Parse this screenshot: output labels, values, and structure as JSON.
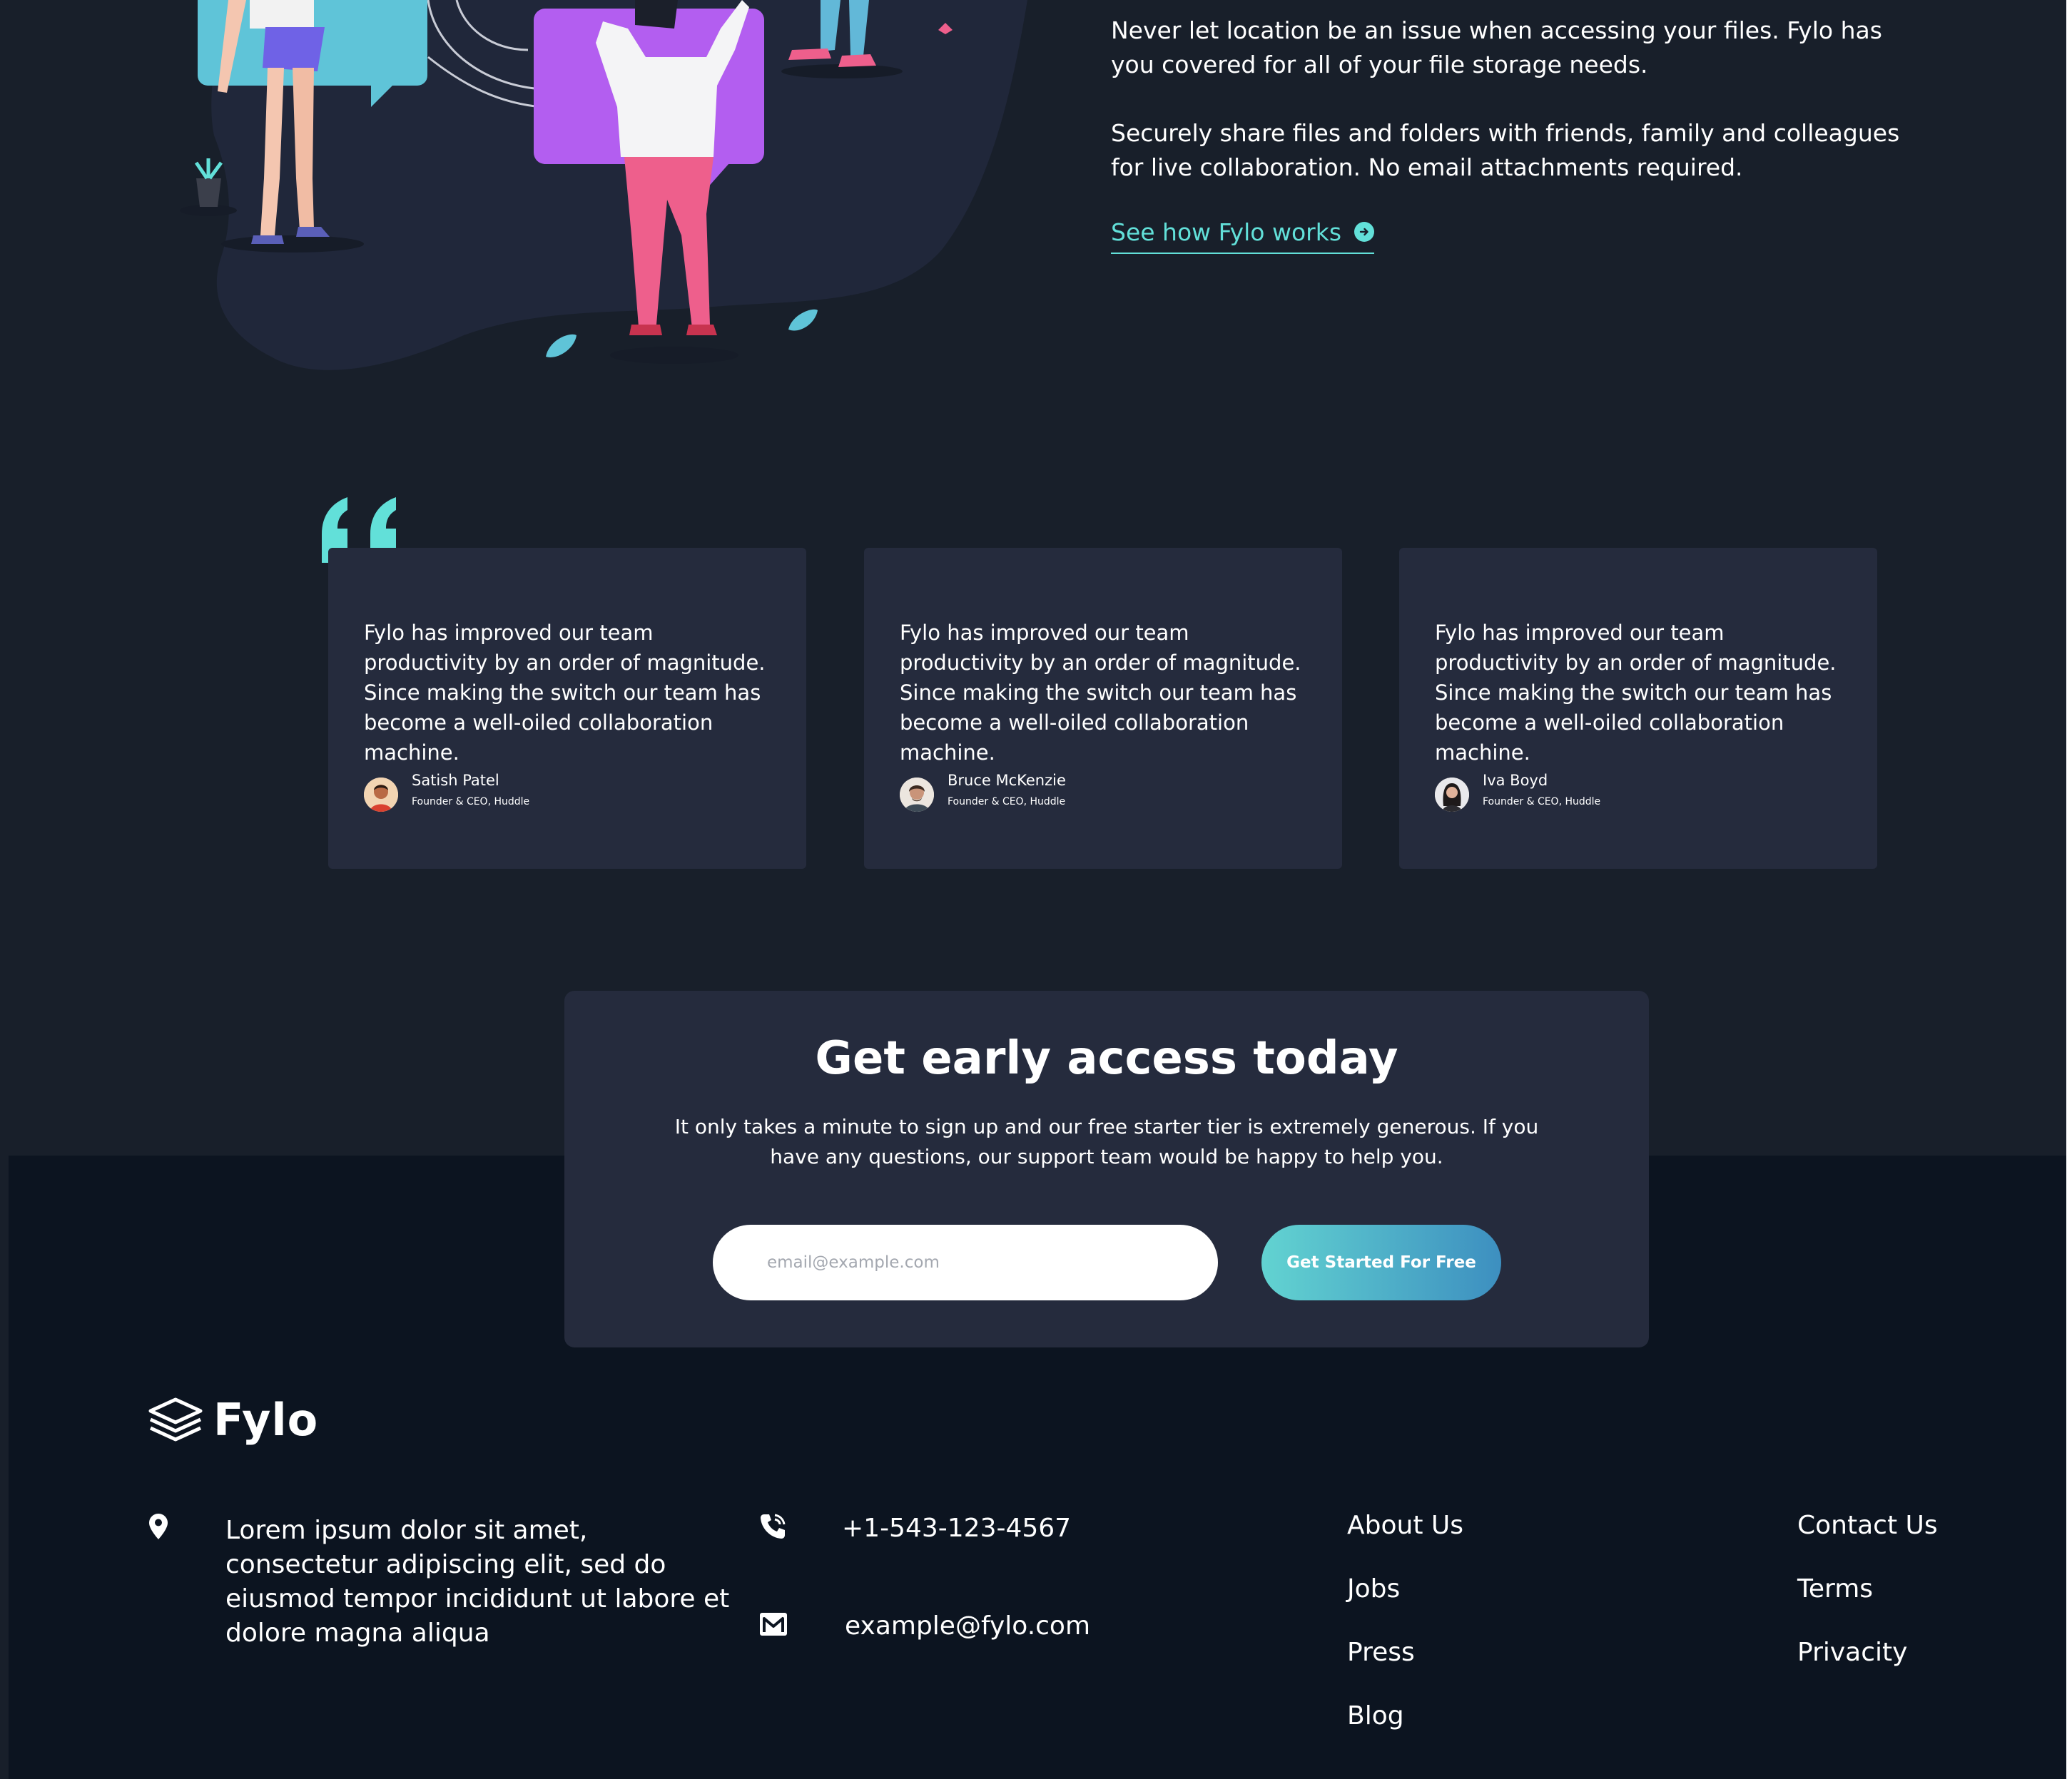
{
  "hero": {
    "paragraph_1": "Never let location be an issue when accessing your files. Fylo has you covered for all of your file storage needs.",
    "paragraph_2": "Securely share files and folders with friends, family and colleagues for live collaboration. No email attachments required.",
    "link_label": "See how Fylo works"
  },
  "testimonials": [
    {
      "quote": "Fylo has improved our team productivity by an order of magnitude. Since making the switch our team has become a well-oiled collaboration machine.",
      "name": "Satish Patel",
      "role": "Founder & CEO, Huddle"
    },
    {
      "quote": "Fylo has improved our team productivity by an order of magnitude. Since making the switch our team has become a well-oiled collaboration machine.",
      "name": "Bruce McKenzie",
      "role": "Founder & CEO, Huddle"
    },
    {
      "quote": "Fylo has improved our team productivity by an order of magnitude. Since making the switch our team has become a well-oiled collaboration machine.",
      "name": "Iva Boyd",
      "role": "Founder & CEO, Huddle"
    }
  ],
  "cta": {
    "title": "Get early access today",
    "subtitle": "It only takes a minute to sign up and our free starter tier is extremely generous. If you have any questions, our support team would be happy to help you.",
    "email_placeholder": "email@example.com",
    "button_label": "Get Started For Free"
  },
  "footer": {
    "logo_text": "Fylo",
    "address": "Lorem ipsum dolor sit amet, consectetur adipiscing elit, sed do eiusmod tempor incididunt ut labore et dolore magna aliqua",
    "phone": "+1-543-123-4567",
    "email": "example@fylo.com",
    "links_col1": [
      "About Us",
      "Jobs",
      "Press",
      "Blog"
    ],
    "links_col2": [
      "Contact Us",
      "Terms",
      "Privacity"
    ]
  },
  "colors": {
    "background": "#181f2a",
    "footer_background": "#0c1420",
    "card_background": "#252b3d",
    "accent_cyan": "#62e0d9",
    "button_gradient_start": "#62d3d1",
    "button_gradient_end": "#3d8fc0"
  },
  "icons": {
    "hero_link": "arrow-right-circle-icon",
    "quote": "quotation-mark-icon",
    "address": "location-pin-icon",
    "phone": "phone-icon",
    "email": "mail-icon",
    "logo": "stacked-layers-icon"
  }
}
